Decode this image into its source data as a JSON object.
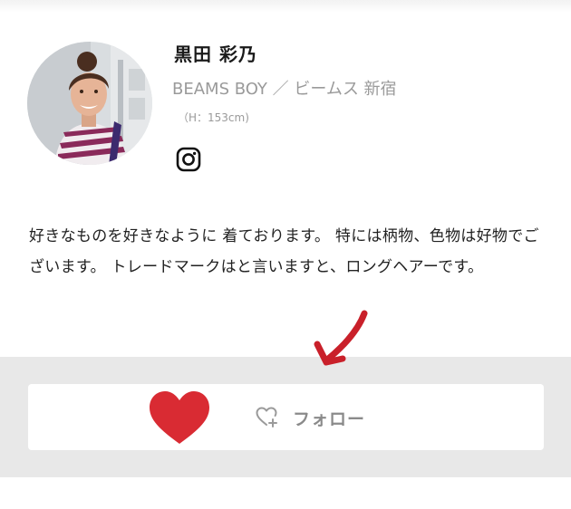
{
  "profile": {
    "name": "黒田 彩乃",
    "shop": "BEAMS BOY ／ ビームス 新宿",
    "height": "（H：153cm)",
    "instagram_icon": "instagram-icon"
  },
  "bio": {
    "text": "好きなものを好きなように 着ております。 特には柄物、色物は好物でございます。 トレードマークはと言いますと、ロングヘアーです。"
  },
  "follow": {
    "label": "フォロー",
    "icon": "heart-plus-icon"
  },
  "annotations": {
    "heart_color": "#d92b33",
    "arrow_color": "#c9202a"
  },
  "colors": {
    "band": "#e8e8e8",
    "muted_text": "#9a9a9a"
  }
}
